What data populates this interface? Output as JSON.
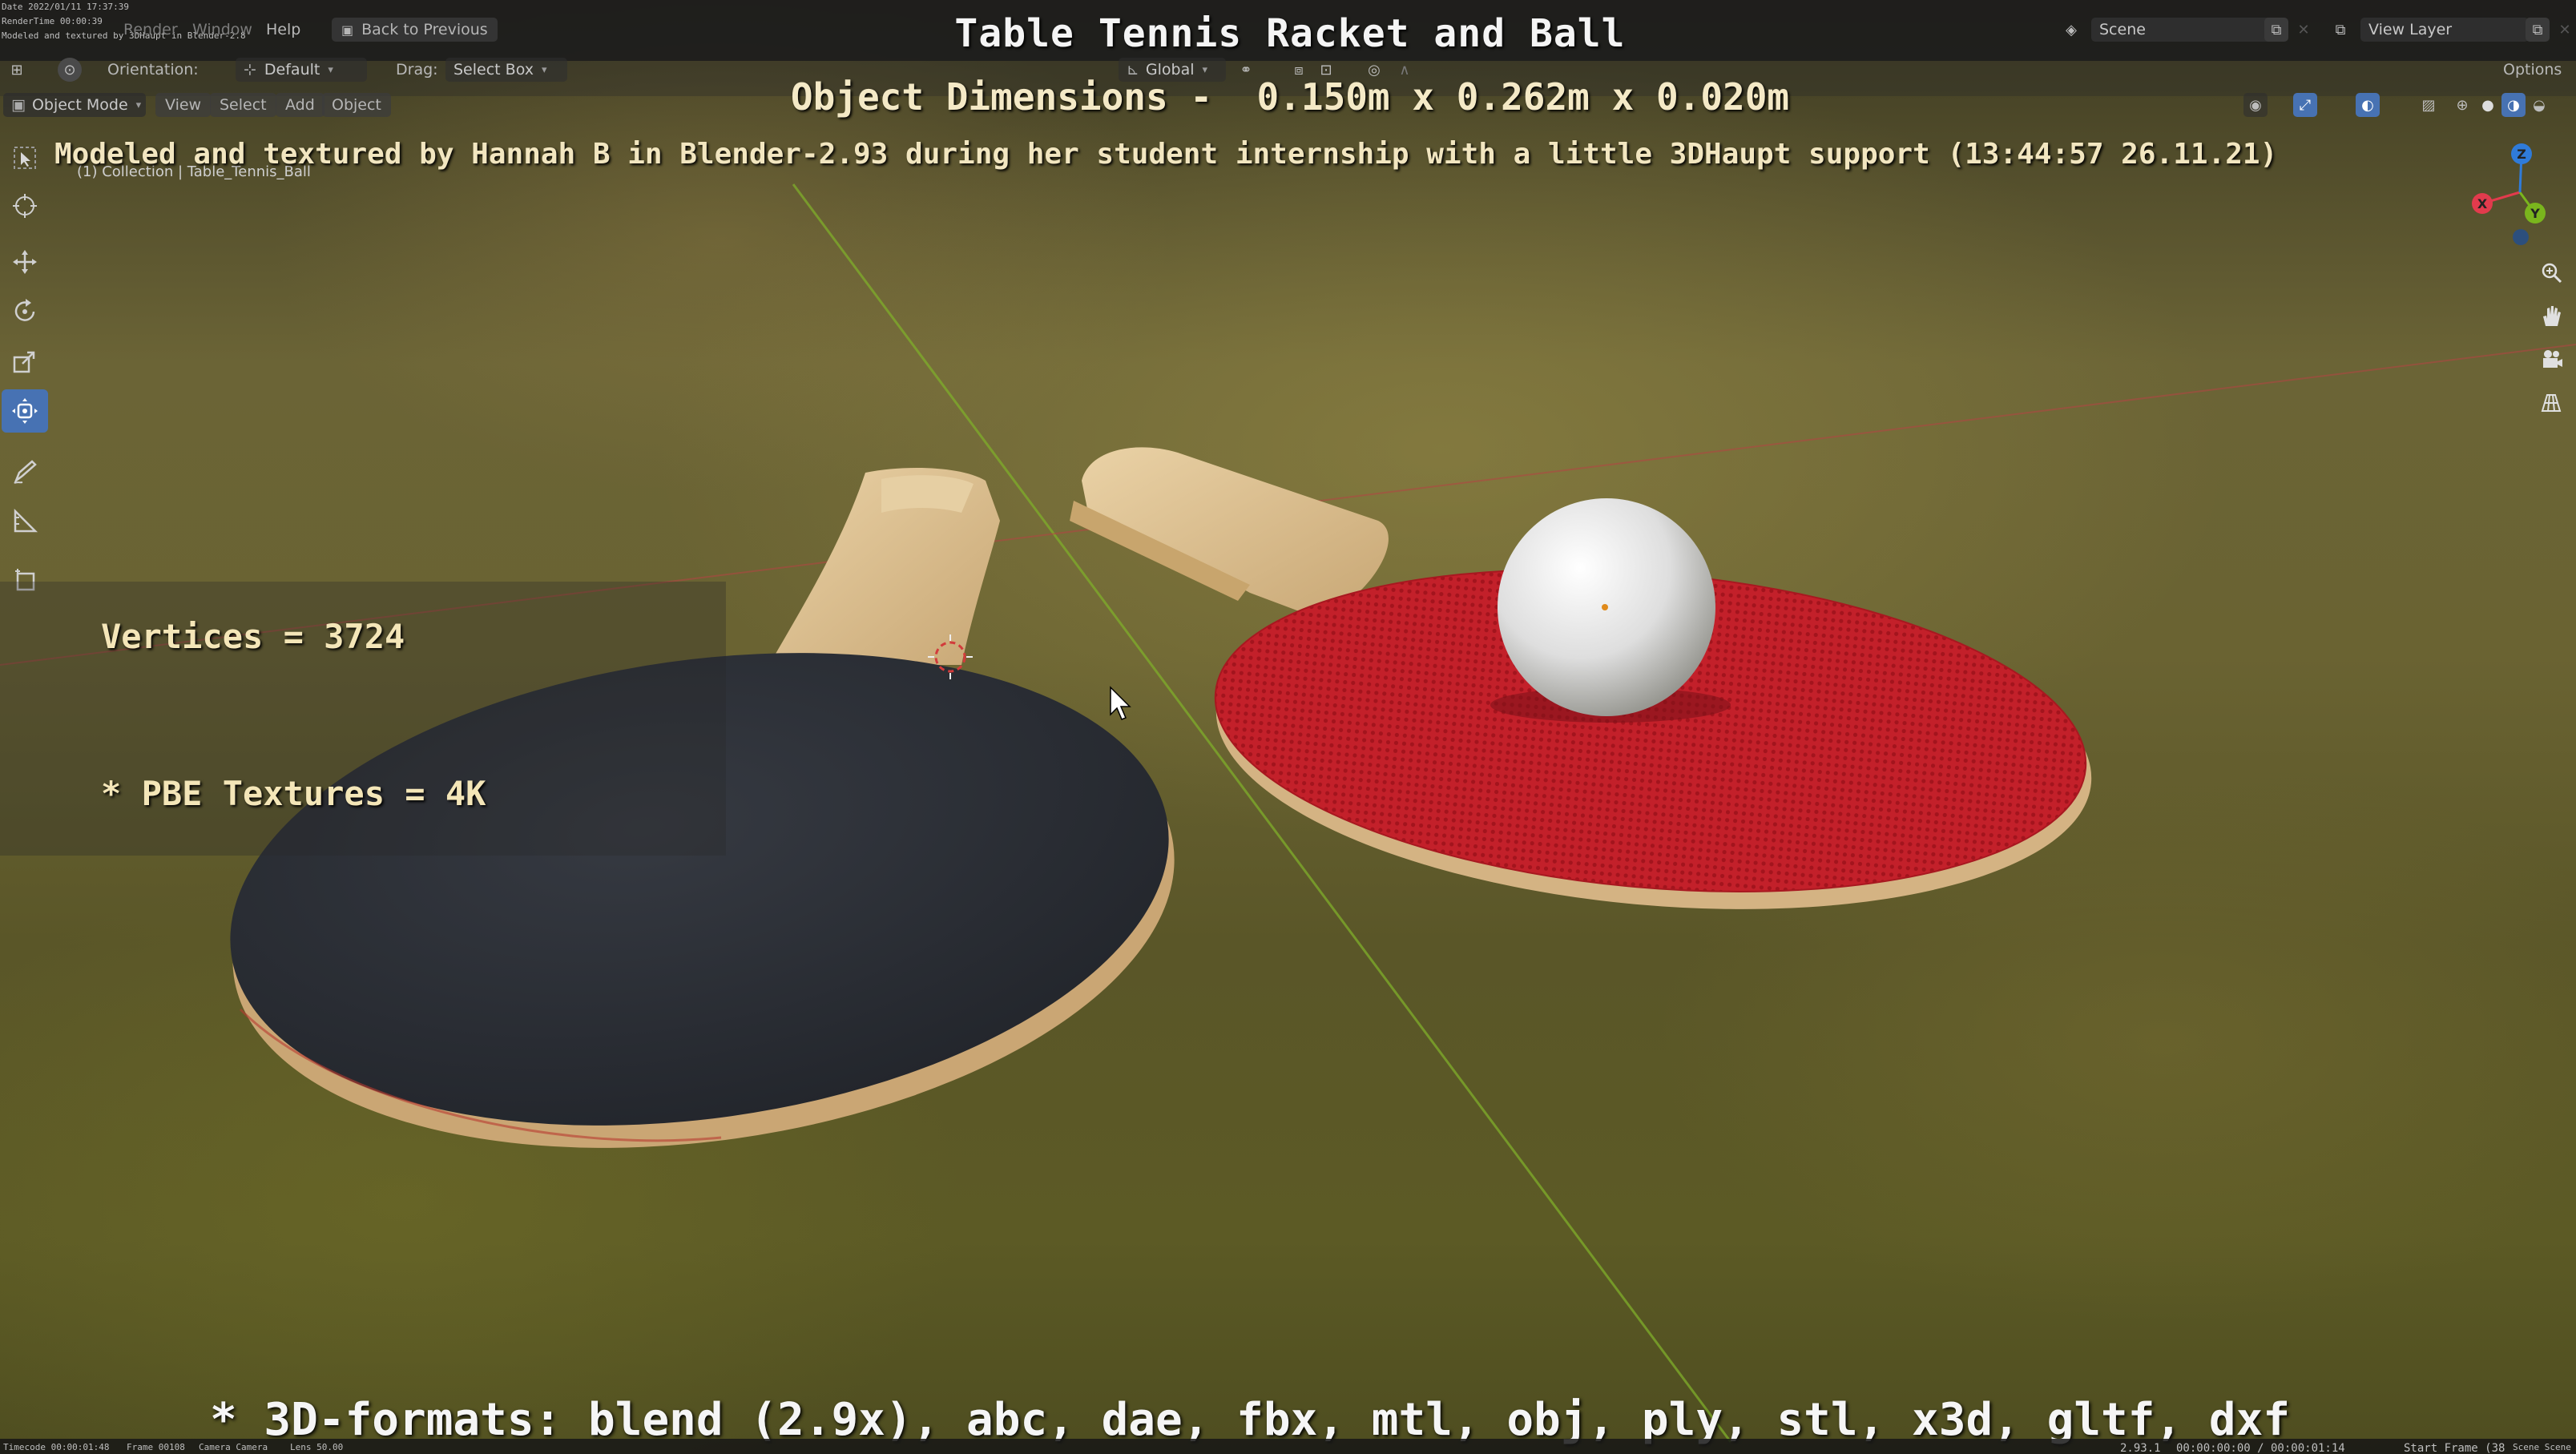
{
  "app": {
    "top_left_info": {
      "date": "Date 2022/01/11 17:37:39",
      "rendertime": "RenderTime 00:00:39",
      "note": "Modeled and textured by 3DHaupt in Blender-2.8"
    },
    "menu": [
      "Render",
      "Window",
      "Help"
    ],
    "back_button": "Back to Previous",
    "scene_field": "Scene",
    "view_layer_field": "View Layer"
  },
  "header": {
    "orientation_label": "Orientation:",
    "orientation_value": "Default",
    "drag_label": "Drag:",
    "drag_value": "Select Box",
    "transform_space": "Global",
    "options_label": "Options"
  },
  "viewport_header": {
    "mode": "Object Mode",
    "menus": [
      "View",
      "Select",
      "Add",
      "Object"
    ]
  },
  "overlay": {
    "title": "Table Tennis Racket and Ball",
    "dimensions": "Object Dimensions -  0.150m x 0.262m x 0.020m",
    "credit": "Modeled and textured by Hannah B in Blender-2.93 during her student internship with a little 3DHaupt support (13:44:57 26.11.21)",
    "collection": "(1) Collection | Table_Tennis_Ball",
    "vertices": "Vertices = 3724",
    "textures": "* PBE Textures = 4K",
    "formats": "* 3D-formats: blend (2.9x), abc, dae, fbx, mtl, obj, ply, stl, x3d, gltf, dxf"
  },
  "gizmo": {
    "x": "X",
    "y": "Y",
    "z": "Z",
    "x_color": "#e23b4d",
    "y_color": "#7ab51d",
    "z_color": "#2f7bd9"
  },
  "statusbar": {
    "left": "Timecode 00:00:01:48",
    "frame": "Frame 00108",
    "camera": "Camera Camera",
    "lens": "Lens 50.00",
    "version": "2.93.1",
    "time": "00:00:00:00 / 00:00:01:14",
    "start_frame": "Start Frame (38",
    "scene": "Scene Scene"
  },
  "colors": {
    "red_rubber": "#c8222c",
    "black_rubber": "#2b2e35",
    "wood": "#d6b888",
    "ball": "#e8e8e4",
    "active_tool": "#4772b3"
  },
  "icons": {
    "tools": [
      "select-box-icon",
      "cursor-icon",
      "move-icon",
      "rotate-icon",
      "scale-icon",
      "transform-icon",
      "annotate-icon",
      "measure-icon",
      "add-cube-icon"
    ],
    "nav": [
      "zoom-icon",
      "hand-pan-icon",
      "camera-icon",
      "grid-ortho-icon"
    ]
  }
}
